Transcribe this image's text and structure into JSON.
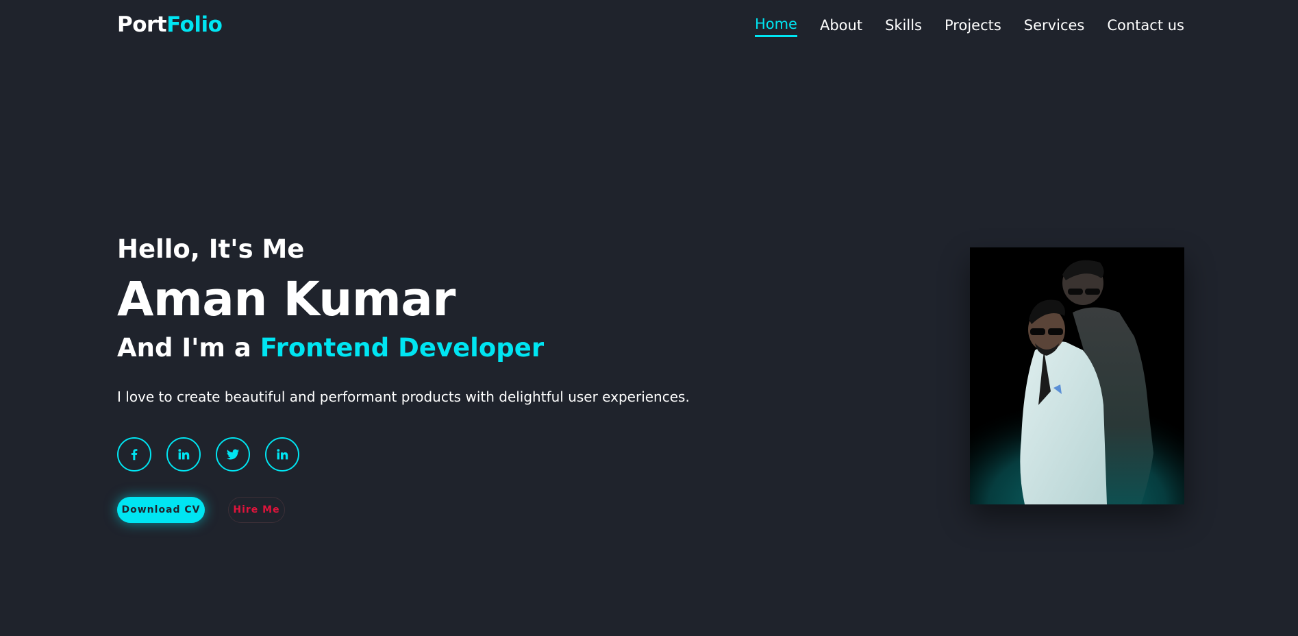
{
  "brand": {
    "logo_part1": "Port",
    "logo_part2": "Folio"
  },
  "nav": {
    "items": [
      {
        "label": "Home",
        "active": true
      },
      {
        "label": "About"
      },
      {
        "label": "Skills"
      },
      {
        "label": "Projects"
      },
      {
        "label": "Services"
      },
      {
        "label": "Contact us"
      }
    ]
  },
  "hero": {
    "greeting": "Hello, It's Me",
    "name": "Aman Kumar",
    "role_prefix": "And I'm a ",
    "role": "Frontend Developer",
    "tagline": "I love to create beautiful and performant products with delightful user experiences."
  },
  "socials": [
    {
      "icon": "facebook-icon"
    },
    {
      "icon": "linkedin-icon"
    },
    {
      "icon": "twitter-icon"
    },
    {
      "icon": "linkedin-icon"
    }
  ],
  "buttons": {
    "download_cv": "Download CV",
    "hire_me": "Hire Me"
  },
  "colors": {
    "background": "#1f232c",
    "accent": "#00e5f2",
    "hire_me_text": "#e0143c"
  }
}
